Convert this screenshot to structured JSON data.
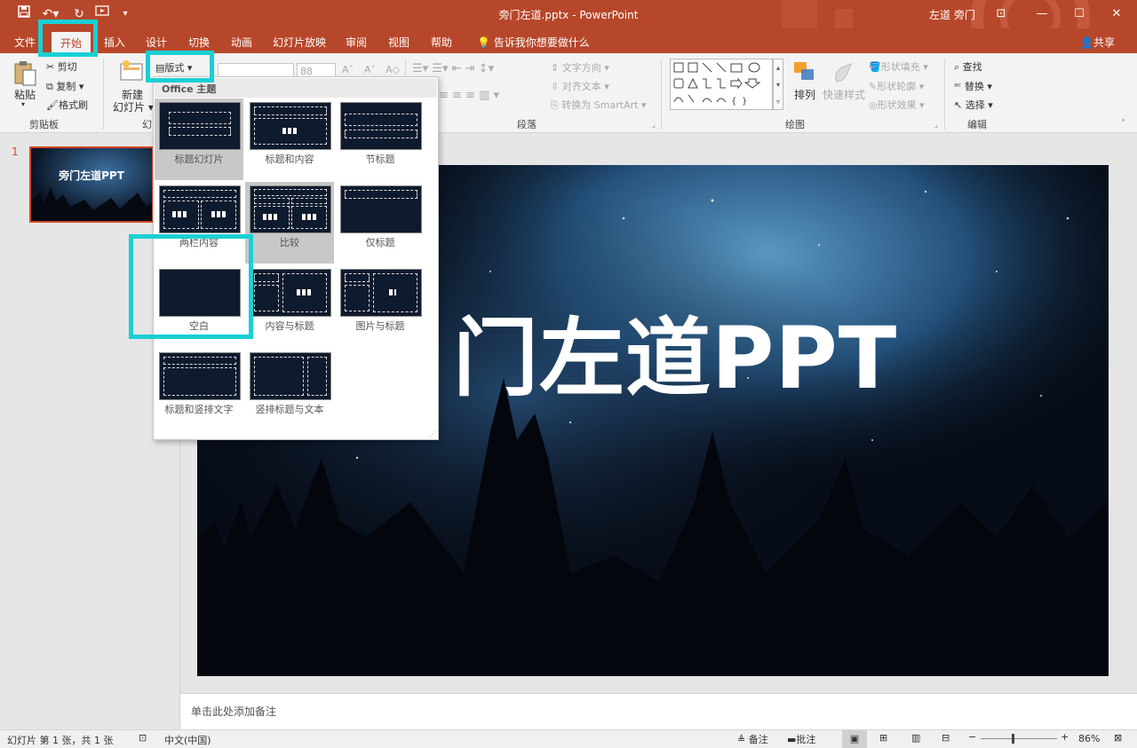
{
  "window": {
    "title": "旁门左道.pptx  -  PowerPoint",
    "user": "左道 旁门"
  },
  "tabs": [
    {
      "label": "文件"
    },
    {
      "label": "开始"
    },
    {
      "label": "插入"
    },
    {
      "label": "设计"
    },
    {
      "label": "切换"
    },
    {
      "label": "动画"
    },
    {
      "label": "幻灯片放映"
    },
    {
      "label": "审阅"
    },
    {
      "label": "视图"
    },
    {
      "label": "帮助"
    }
  ],
  "tell_me": "告诉我你想要做什么",
  "share": "共享",
  "ribbon": {
    "clipboard": {
      "paste": "粘贴",
      "cut": "剪切",
      "copy": "复制",
      "format_painter": "格式刷",
      "label": "剪贴板"
    },
    "slides": {
      "new_slide_1": "新建",
      "new_slide_2": "幻灯片",
      "layout": "版式",
      "label": "幻"
    },
    "font": {
      "size": "88"
    },
    "paragraph": {
      "text_direction": "文字方向",
      "align_text": "对齐文本",
      "smartart": "转换为 SmartArt",
      "label": "段落"
    },
    "drawing": {
      "arrange": "排列",
      "quick_styles": "快速样式",
      "fill": "形状填充",
      "outline": "形状轮廓",
      "effects": "形状效果",
      "label": "绘图"
    },
    "editing": {
      "find": "查找",
      "replace": "替换",
      "select": "选择",
      "label": "编辑"
    }
  },
  "layout_menu": {
    "header": "Office 主题",
    "items": [
      {
        "label": "标题幻灯片"
      },
      {
        "label": "标题和内容"
      },
      {
        "label": "节标题"
      },
      {
        "label": "两栏内容"
      },
      {
        "label": "比较"
      },
      {
        "label": "仅标题"
      },
      {
        "label": "空白"
      },
      {
        "label": "内容与标题"
      },
      {
        "label": "图片与标题"
      },
      {
        "label": "标题和竖排文字"
      },
      {
        "label": "竖排标题与文本"
      }
    ]
  },
  "thumbnail": {
    "number": "1",
    "title": "旁门左道PPT"
  },
  "slide": {
    "title": "门左道PPT"
  },
  "notes": {
    "placeholder": "单击此处添加备注"
  },
  "status": {
    "slide_info": "幻灯片 第 1 张，共 1 张",
    "language": "中文(中国)",
    "notes": "备注",
    "comments": "批注",
    "zoom": "86%",
    "zoom_level": 0.86
  },
  "colors": {
    "accent": "#b7472a",
    "highlight": "#19d0d4"
  }
}
